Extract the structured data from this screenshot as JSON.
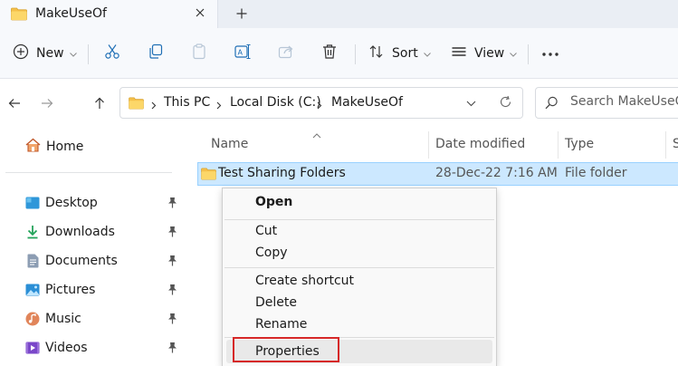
{
  "tab": {
    "title": "MakeUseOf"
  },
  "toolbar": {
    "new_label": "New",
    "sort_label": "Sort",
    "view_label": "View"
  },
  "address": {
    "crumbs": [
      "This PC",
      "Local Disk (C:)",
      "MakeUseOf"
    ]
  },
  "search": {
    "placeholder": "Search MakeUseOf"
  },
  "sidebar": {
    "home": "Home",
    "items": [
      {
        "label": "Desktop",
        "icon": "desktop-icon"
      },
      {
        "label": "Downloads",
        "icon": "download-icon"
      },
      {
        "label": "Documents",
        "icon": "document-icon"
      },
      {
        "label": "Pictures",
        "icon": "picture-icon"
      },
      {
        "label": "Music",
        "icon": "music-icon"
      },
      {
        "label": "Videos",
        "icon": "video-icon"
      }
    ]
  },
  "columns": [
    "Name",
    "Date modified",
    "Type",
    "S"
  ],
  "rows": [
    {
      "name": "Test Sharing Folders",
      "date": "28-Dec-22 7:16 AM",
      "type": "File folder"
    }
  ],
  "context_menu": {
    "open": "Open",
    "cut": "Cut",
    "copy": "Copy",
    "create_shortcut": "Create shortcut",
    "delete": "Delete",
    "rename": "Rename",
    "properties": "Properties"
  },
  "colors": {
    "folder": "#f5c04a",
    "selection": "#cce8ff",
    "highlight_box": "#d62828"
  }
}
